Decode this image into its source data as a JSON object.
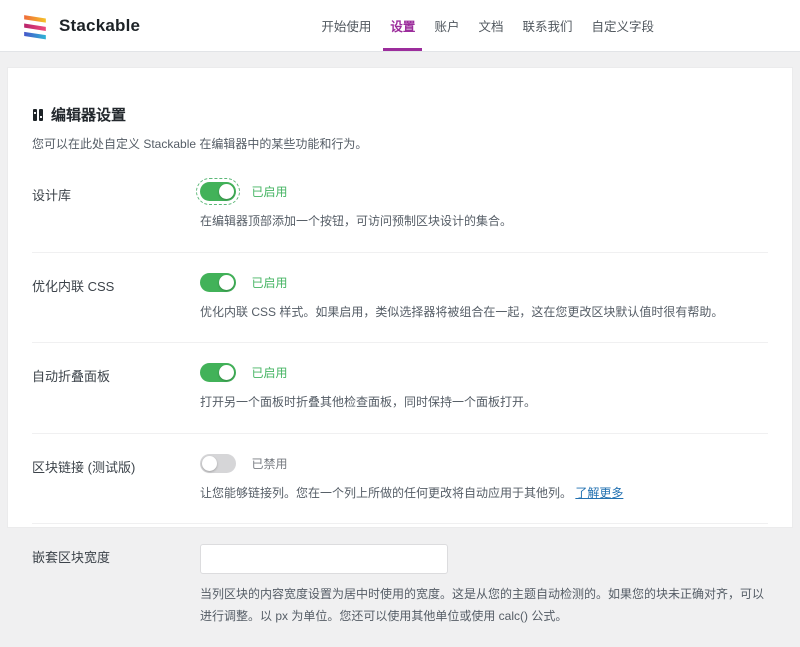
{
  "brand": {
    "name": "Stackable"
  },
  "nav": {
    "items": [
      {
        "label": "开始使用",
        "active": false
      },
      {
        "label": "设置",
        "active": true
      },
      {
        "label": "账户",
        "active": false
      },
      {
        "label": "文档",
        "active": false
      },
      {
        "label": "联系我们",
        "active": false
      },
      {
        "label": "自定义字段",
        "active": false
      }
    ]
  },
  "page": {
    "title": "编辑器设置",
    "subtitle": "您可以在此处自定义 Stackable 在编辑器中的某些功能和行为。"
  },
  "settings": {
    "rows": [
      {
        "label": "设计库",
        "control": "toggle",
        "state": "on",
        "status": "已启用",
        "description": "在编辑器顶部添加一个按钮，可访问预制区块设计的集合。"
      },
      {
        "label": "优化内联 CSS",
        "control": "toggle",
        "state": "on",
        "status": "已启用",
        "description": "优化内联 CSS 样式。如果启用，类似选择器将被组合在一起，这在您更改区块默认值时很有帮助。"
      },
      {
        "label": "自动折叠面板",
        "control": "toggle",
        "state": "on",
        "status": "已启用",
        "description": "打开另一个面板时折叠其他检查面板，同时保持一个面板打开。"
      },
      {
        "label": "区块链接 (测试版)",
        "control": "toggle",
        "state": "off",
        "status": "已禁用",
        "description": "让您能够链接列。您在一个列上所做的任何更改将自动应用于其他列。",
        "link_label": "了解更多"
      },
      {
        "label": "嵌套区块宽度",
        "control": "input",
        "input_value": "",
        "description": "当列区块的内容宽度设置为居中时使用的宽度。这是从您的主题自动检测的。如果您的块未正确对齐，可以进行调整。以 px 为单位。您还可以使用其他单位或使用 calc() 公式。"
      }
    ]
  },
  "colors": {
    "accent_purple": "#9c2d9c",
    "toggle_on_green": "#42b259",
    "status_enabled_green": "#45b463",
    "status_disabled_gray": "#787c82",
    "link_blue": "#2271b1",
    "page_background": "#f0f0f1"
  }
}
